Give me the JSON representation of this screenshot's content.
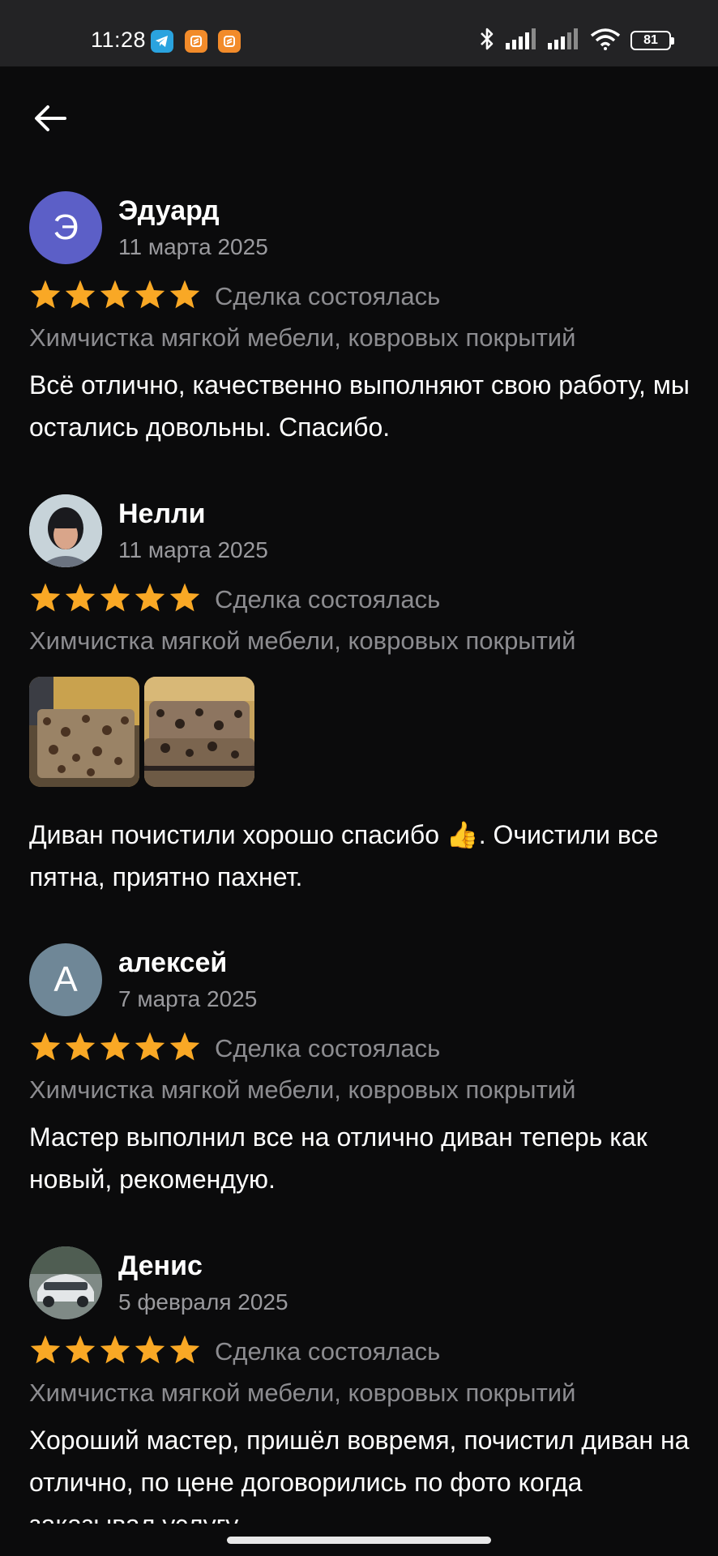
{
  "status_bar": {
    "time": "11:28",
    "battery": "81",
    "icons": [
      "telegram-icon",
      "app-icon",
      "app-icon",
      "bluetooth-icon",
      "signal-icon",
      "signal-icon",
      "wifi-icon",
      "battery-icon"
    ]
  },
  "nav": {
    "back_icon": "arrow-left-icon"
  },
  "colors": {
    "background": "#0b0b0c",
    "star": "#f9a825",
    "muted": "#8c8c90"
  },
  "reviews": [
    {
      "author": "Эдуард",
      "avatar_letter": "Э",
      "avatar_color": "#5c5fc7",
      "date": "11 марта 2025",
      "rating": 5,
      "deal_status": "Сделка состоялась",
      "service": "Химчистка мягкой мебели, ковровых покрытий",
      "text": "Всё отлично, качественно выполняют свою работу, мы остались довольны. Спасибо."
    },
    {
      "author": "Нелли",
      "date": "11 марта 2025",
      "rating": 5,
      "deal_status": "Сделка состоялась",
      "service": "Химчистка мягкой мебели, ковровых покрытий",
      "photos": 2,
      "text": "Диван почистили хорошо спасибо 👍. Очистили все пятна, приятно пахнет."
    },
    {
      "author": "алексей",
      "avatar_letter": "А",
      "avatar_color": "#6f8797",
      "date": "7 марта 2025",
      "rating": 5,
      "deal_status": "Сделка состоялась",
      "service": "Химчистка мягкой мебели, ковровых покрытий",
      "text": "Мастер выполнил все на отлично диван теперь как новый, рекомендую."
    },
    {
      "author": "Денис",
      "date": "5 февраля 2025",
      "rating": 5,
      "deal_status": "Сделка состоялась",
      "service": "Химчистка мягкой мебели, ковровых покрытий",
      "text": "Хороший мастер, пришёл вовремя, почистил диван на отлично, по цене договорились по фото когда заказывал услугу."
    }
  ]
}
